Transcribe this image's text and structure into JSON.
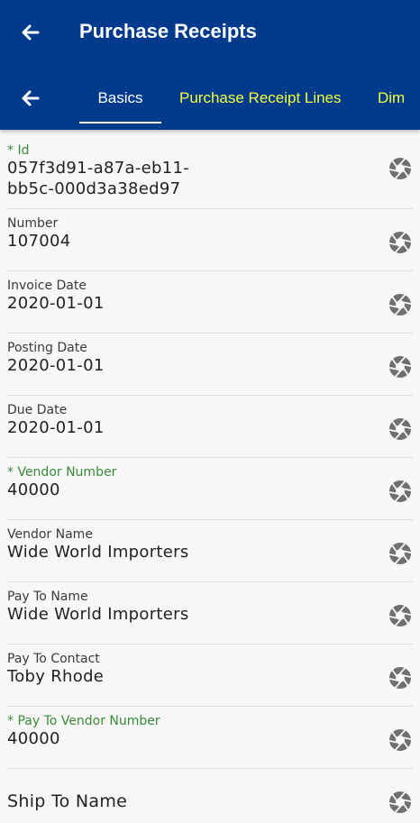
{
  "header": {
    "title": "Purchase Receipts",
    "back_icon": "back-arrow-icon"
  },
  "tabs": [
    {
      "label": "Basics",
      "active": true
    },
    {
      "label": "Purchase Receipt Lines",
      "active": false
    },
    {
      "label": "Dim",
      "active": false
    }
  ],
  "colors": {
    "header_bg": "#003a8c",
    "inactive_tab": "#f5ff3b",
    "required_label": "#3a8a3a"
  },
  "fields": [
    {
      "label": "* Id",
      "required": true,
      "value_line1": "057f3d91-a87a-eb11-",
      "value_line2": "bb5c-000d3a38ed97",
      "action_icon": "camera-icon"
    },
    {
      "label": "Number",
      "required": false,
      "value": "107004",
      "action_icon": "camera-icon"
    },
    {
      "label": "Invoice Date",
      "required": false,
      "value": "2020-01-01",
      "action_icon": "camera-icon"
    },
    {
      "label": "Posting Date",
      "required": false,
      "value": "2020-01-01",
      "action_icon": "camera-icon"
    },
    {
      "label": "Due Date",
      "required": false,
      "value": "2020-01-01",
      "action_icon": "camera-icon"
    },
    {
      "label": "* Vendor Number",
      "required": true,
      "value": "40000",
      "action_icon": "camera-icon"
    },
    {
      "label": "Vendor Name",
      "required": false,
      "value": "Wide World Importers",
      "action_icon": "camera-icon"
    },
    {
      "label": "Pay To Name",
      "required": false,
      "value": "Wide World Importers",
      "action_icon": "camera-icon"
    },
    {
      "label": "Pay To Contact",
      "required": false,
      "value": "Toby Rhode",
      "action_icon": "camera-icon"
    },
    {
      "label": "* Pay To Vendor Number",
      "required": true,
      "value": "40000",
      "action_icon": "camera-icon"
    },
    {
      "placeholder": "Ship To Name",
      "action_icon": "camera-icon"
    }
  ]
}
